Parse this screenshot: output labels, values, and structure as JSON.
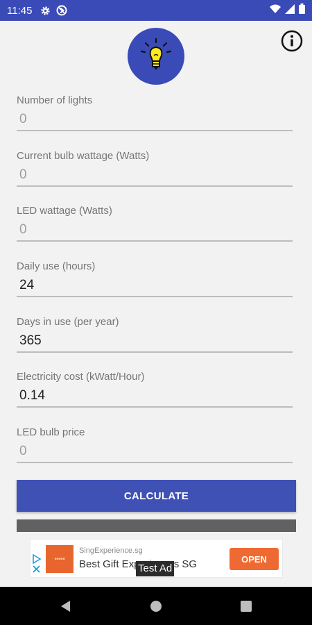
{
  "status_bar": {
    "time": "11:45",
    "icons": [
      "gear-icon",
      "do-not-disturb-icon",
      "wifi-icon",
      "cellular-signal-icon",
      "battery-icon"
    ]
  },
  "header": {
    "logo_icon": "lightbulb-icon",
    "info_icon": "info-icon"
  },
  "fields": [
    {
      "label": "Number of lights",
      "value": "",
      "placeholder": "0"
    },
    {
      "label": "Current bulb wattage (Watts)",
      "value": "",
      "placeholder": "0"
    },
    {
      "label": "LED wattage (Watts)",
      "value": "",
      "placeholder": "0"
    },
    {
      "label": "Daily use (hours)",
      "value": "24",
      "placeholder": "0"
    },
    {
      "label": "Days in use (per year)",
      "value": "365",
      "placeholder": "0"
    },
    {
      "label": "Electricity cost (kWatt/Hour)",
      "value": "0.14",
      "placeholder": "0"
    },
    {
      "label": "LED bulb price",
      "value": "",
      "placeholder": "0"
    }
  ],
  "calculate_label": "CALCULATE",
  "ad": {
    "test_label": "Test Ad",
    "advertiser": "SingExperience.sg",
    "headline": "Best Gift Experiences SG",
    "open_label": "OPEN"
  },
  "nav_bar": {
    "icons": [
      "back-icon",
      "home-icon",
      "recents-icon"
    ]
  },
  "colors": {
    "primary": "#3f51b5",
    "status_bar": "#3a4bb8",
    "ad_button": "#ef6a32",
    "result_bar": "#616161"
  }
}
